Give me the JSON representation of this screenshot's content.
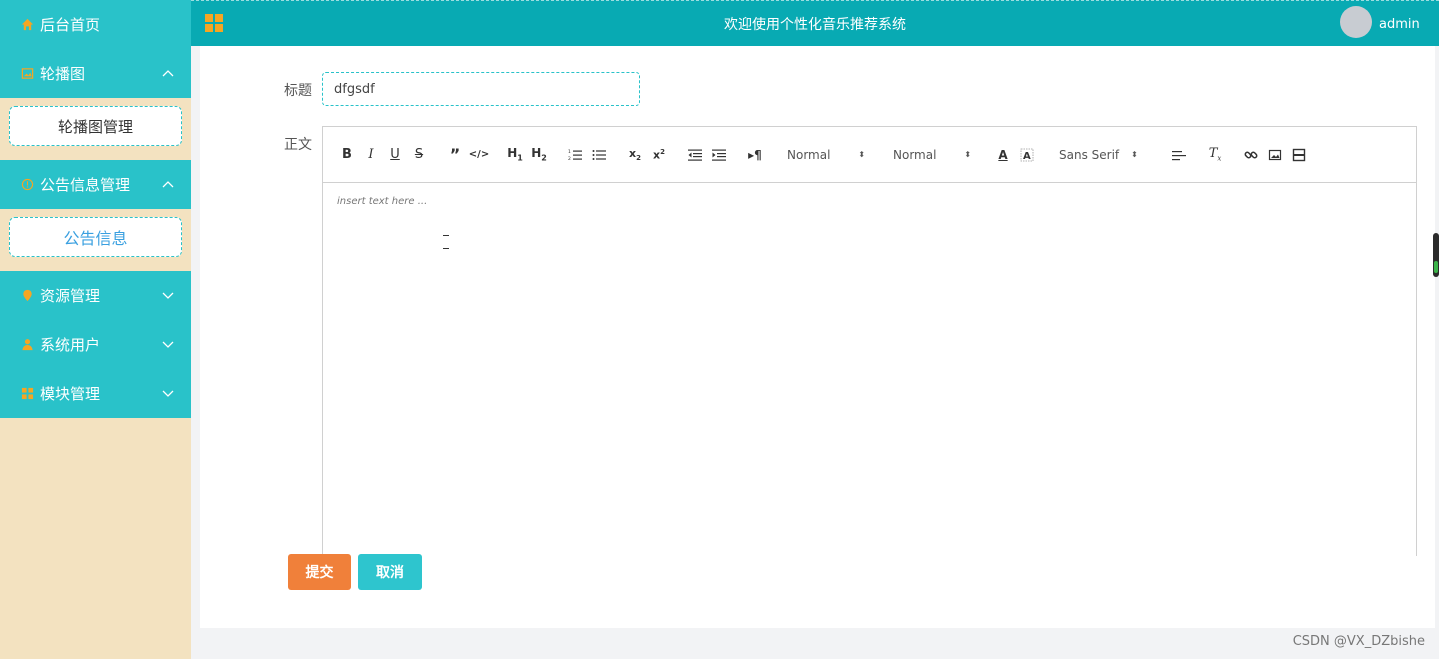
{
  "sidebar": {
    "items": [
      {
        "label": "后台首页",
        "icon": "home-icon",
        "expanded": null
      },
      {
        "label": "轮播图",
        "icon": "image-icon",
        "expanded": true,
        "children": [
          {
            "label": "轮播图管理",
            "active": false
          }
        ]
      },
      {
        "label": "公告信息管理",
        "icon": "info-icon",
        "expanded": true,
        "children": [
          {
            "label": "公告信息",
            "active": true
          }
        ]
      },
      {
        "label": "资源管理",
        "icon": "pin-icon",
        "expanded": false
      },
      {
        "label": "系统用户",
        "icon": "user-icon",
        "expanded": false
      },
      {
        "label": "模块管理",
        "icon": "grid-icon",
        "expanded": false
      }
    ]
  },
  "header": {
    "title": "欢迎使用个性化音乐推荐系统",
    "user": "admin"
  },
  "form": {
    "title_label": "标题",
    "title_value": "dfgsdf",
    "content_label": "正文",
    "placeholder": "insert text here ...",
    "submit_label": "提交",
    "cancel_label": "取消"
  },
  "editor": {
    "header_picker": "Normal",
    "size_picker": "Normal",
    "font_picker": "Sans Serif"
  },
  "watermark": "CSDN @VX_DZbishe",
  "colors": {
    "sidebar_bg": "#f3e2c0",
    "menu_bg": "#29c2c9",
    "header_bg": "#08aab3",
    "submit": "#f0803a",
    "cancel": "#2ec5ce",
    "icon_accent": "#f5a623"
  }
}
